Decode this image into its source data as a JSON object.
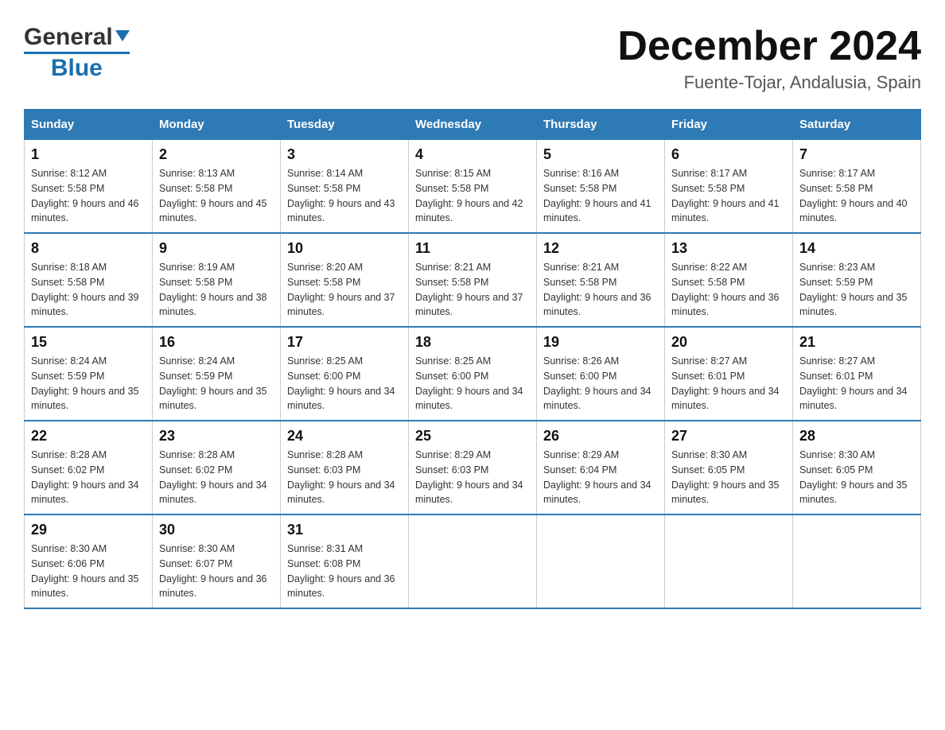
{
  "header": {
    "logo_general": "General",
    "logo_blue": "Blue",
    "month_title": "December 2024",
    "location": "Fuente-Tojar, Andalusia, Spain"
  },
  "days_of_week": [
    "Sunday",
    "Monday",
    "Tuesday",
    "Wednesday",
    "Thursday",
    "Friday",
    "Saturday"
  ],
  "weeks": [
    [
      {
        "day": "1",
        "sunrise": "Sunrise: 8:12 AM",
        "sunset": "Sunset: 5:58 PM",
        "daylight": "Daylight: 9 hours and 46 minutes."
      },
      {
        "day": "2",
        "sunrise": "Sunrise: 8:13 AM",
        "sunset": "Sunset: 5:58 PM",
        "daylight": "Daylight: 9 hours and 45 minutes."
      },
      {
        "day": "3",
        "sunrise": "Sunrise: 8:14 AM",
        "sunset": "Sunset: 5:58 PM",
        "daylight": "Daylight: 9 hours and 43 minutes."
      },
      {
        "day": "4",
        "sunrise": "Sunrise: 8:15 AM",
        "sunset": "Sunset: 5:58 PM",
        "daylight": "Daylight: 9 hours and 42 minutes."
      },
      {
        "day": "5",
        "sunrise": "Sunrise: 8:16 AM",
        "sunset": "Sunset: 5:58 PM",
        "daylight": "Daylight: 9 hours and 41 minutes."
      },
      {
        "day": "6",
        "sunrise": "Sunrise: 8:17 AM",
        "sunset": "Sunset: 5:58 PM",
        "daylight": "Daylight: 9 hours and 41 minutes."
      },
      {
        "day": "7",
        "sunrise": "Sunrise: 8:17 AM",
        "sunset": "Sunset: 5:58 PM",
        "daylight": "Daylight: 9 hours and 40 minutes."
      }
    ],
    [
      {
        "day": "8",
        "sunrise": "Sunrise: 8:18 AM",
        "sunset": "Sunset: 5:58 PM",
        "daylight": "Daylight: 9 hours and 39 minutes."
      },
      {
        "day": "9",
        "sunrise": "Sunrise: 8:19 AM",
        "sunset": "Sunset: 5:58 PM",
        "daylight": "Daylight: 9 hours and 38 minutes."
      },
      {
        "day": "10",
        "sunrise": "Sunrise: 8:20 AM",
        "sunset": "Sunset: 5:58 PM",
        "daylight": "Daylight: 9 hours and 37 minutes."
      },
      {
        "day": "11",
        "sunrise": "Sunrise: 8:21 AM",
        "sunset": "Sunset: 5:58 PM",
        "daylight": "Daylight: 9 hours and 37 minutes."
      },
      {
        "day": "12",
        "sunrise": "Sunrise: 8:21 AM",
        "sunset": "Sunset: 5:58 PM",
        "daylight": "Daylight: 9 hours and 36 minutes."
      },
      {
        "day": "13",
        "sunrise": "Sunrise: 8:22 AM",
        "sunset": "Sunset: 5:58 PM",
        "daylight": "Daylight: 9 hours and 36 minutes."
      },
      {
        "day": "14",
        "sunrise": "Sunrise: 8:23 AM",
        "sunset": "Sunset: 5:59 PM",
        "daylight": "Daylight: 9 hours and 35 minutes."
      }
    ],
    [
      {
        "day": "15",
        "sunrise": "Sunrise: 8:24 AM",
        "sunset": "Sunset: 5:59 PM",
        "daylight": "Daylight: 9 hours and 35 minutes."
      },
      {
        "day": "16",
        "sunrise": "Sunrise: 8:24 AM",
        "sunset": "Sunset: 5:59 PM",
        "daylight": "Daylight: 9 hours and 35 minutes."
      },
      {
        "day": "17",
        "sunrise": "Sunrise: 8:25 AM",
        "sunset": "Sunset: 6:00 PM",
        "daylight": "Daylight: 9 hours and 34 minutes."
      },
      {
        "day": "18",
        "sunrise": "Sunrise: 8:25 AM",
        "sunset": "Sunset: 6:00 PM",
        "daylight": "Daylight: 9 hours and 34 minutes."
      },
      {
        "day": "19",
        "sunrise": "Sunrise: 8:26 AM",
        "sunset": "Sunset: 6:00 PM",
        "daylight": "Daylight: 9 hours and 34 minutes."
      },
      {
        "day": "20",
        "sunrise": "Sunrise: 8:27 AM",
        "sunset": "Sunset: 6:01 PM",
        "daylight": "Daylight: 9 hours and 34 minutes."
      },
      {
        "day": "21",
        "sunrise": "Sunrise: 8:27 AM",
        "sunset": "Sunset: 6:01 PM",
        "daylight": "Daylight: 9 hours and 34 minutes."
      }
    ],
    [
      {
        "day": "22",
        "sunrise": "Sunrise: 8:28 AM",
        "sunset": "Sunset: 6:02 PM",
        "daylight": "Daylight: 9 hours and 34 minutes."
      },
      {
        "day": "23",
        "sunrise": "Sunrise: 8:28 AM",
        "sunset": "Sunset: 6:02 PM",
        "daylight": "Daylight: 9 hours and 34 minutes."
      },
      {
        "day": "24",
        "sunrise": "Sunrise: 8:28 AM",
        "sunset": "Sunset: 6:03 PM",
        "daylight": "Daylight: 9 hours and 34 minutes."
      },
      {
        "day": "25",
        "sunrise": "Sunrise: 8:29 AM",
        "sunset": "Sunset: 6:03 PM",
        "daylight": "Daylight: 9 hours and 34 minutes."
      },
      {
        "day": "26",
        "sunrise": "Sunrise: 8:29 AM",
        "sunset": "Sunset: 6:04 PM",
        "daylight": "Daylight: 9 hours and 34 minutes."
      },
      {
        "day": "27",
        "sunrise": "Sunrise: 8:30 AM",
        "sunset": "Sunset: 6:05 PM",
        "daylight": "Daylight: 9 hours and 35 minutes."
      },
      {
        "day": "28",
        "sunrise": "Sunrise: 8:30 AM",
        "sunset": "Sunset: 6:05 PM",
        "daylight": "Daylight: 9 hours and 35 minutes."
      }
    ],
    [
      {
        "day": "29",
        "sunrise": "Sunrise: 8:30 AM",
        "sunset": "Sunset: 6:06 PM",
        "daylight": "Daylight: 9 hours and 35 minutes."
      },
      {
        "day": "30",
        "sunrise": "Sunrise: 8:30 AM",
        "sunset": "Sunset: 6:07 PM",
        "daylight": "Daylight: 9 hours and 36 minutes."
      },
      {
        "day": "31",
        "sunrise": "Sunrise: 8:31 AM",
        "sunset": "Sunset: 6:08 PM",
        "daylight": "Daylight: 9 hours and 36 minutes."
      },
      null,
      null,
      null,
      null
    ]
  ]
}
